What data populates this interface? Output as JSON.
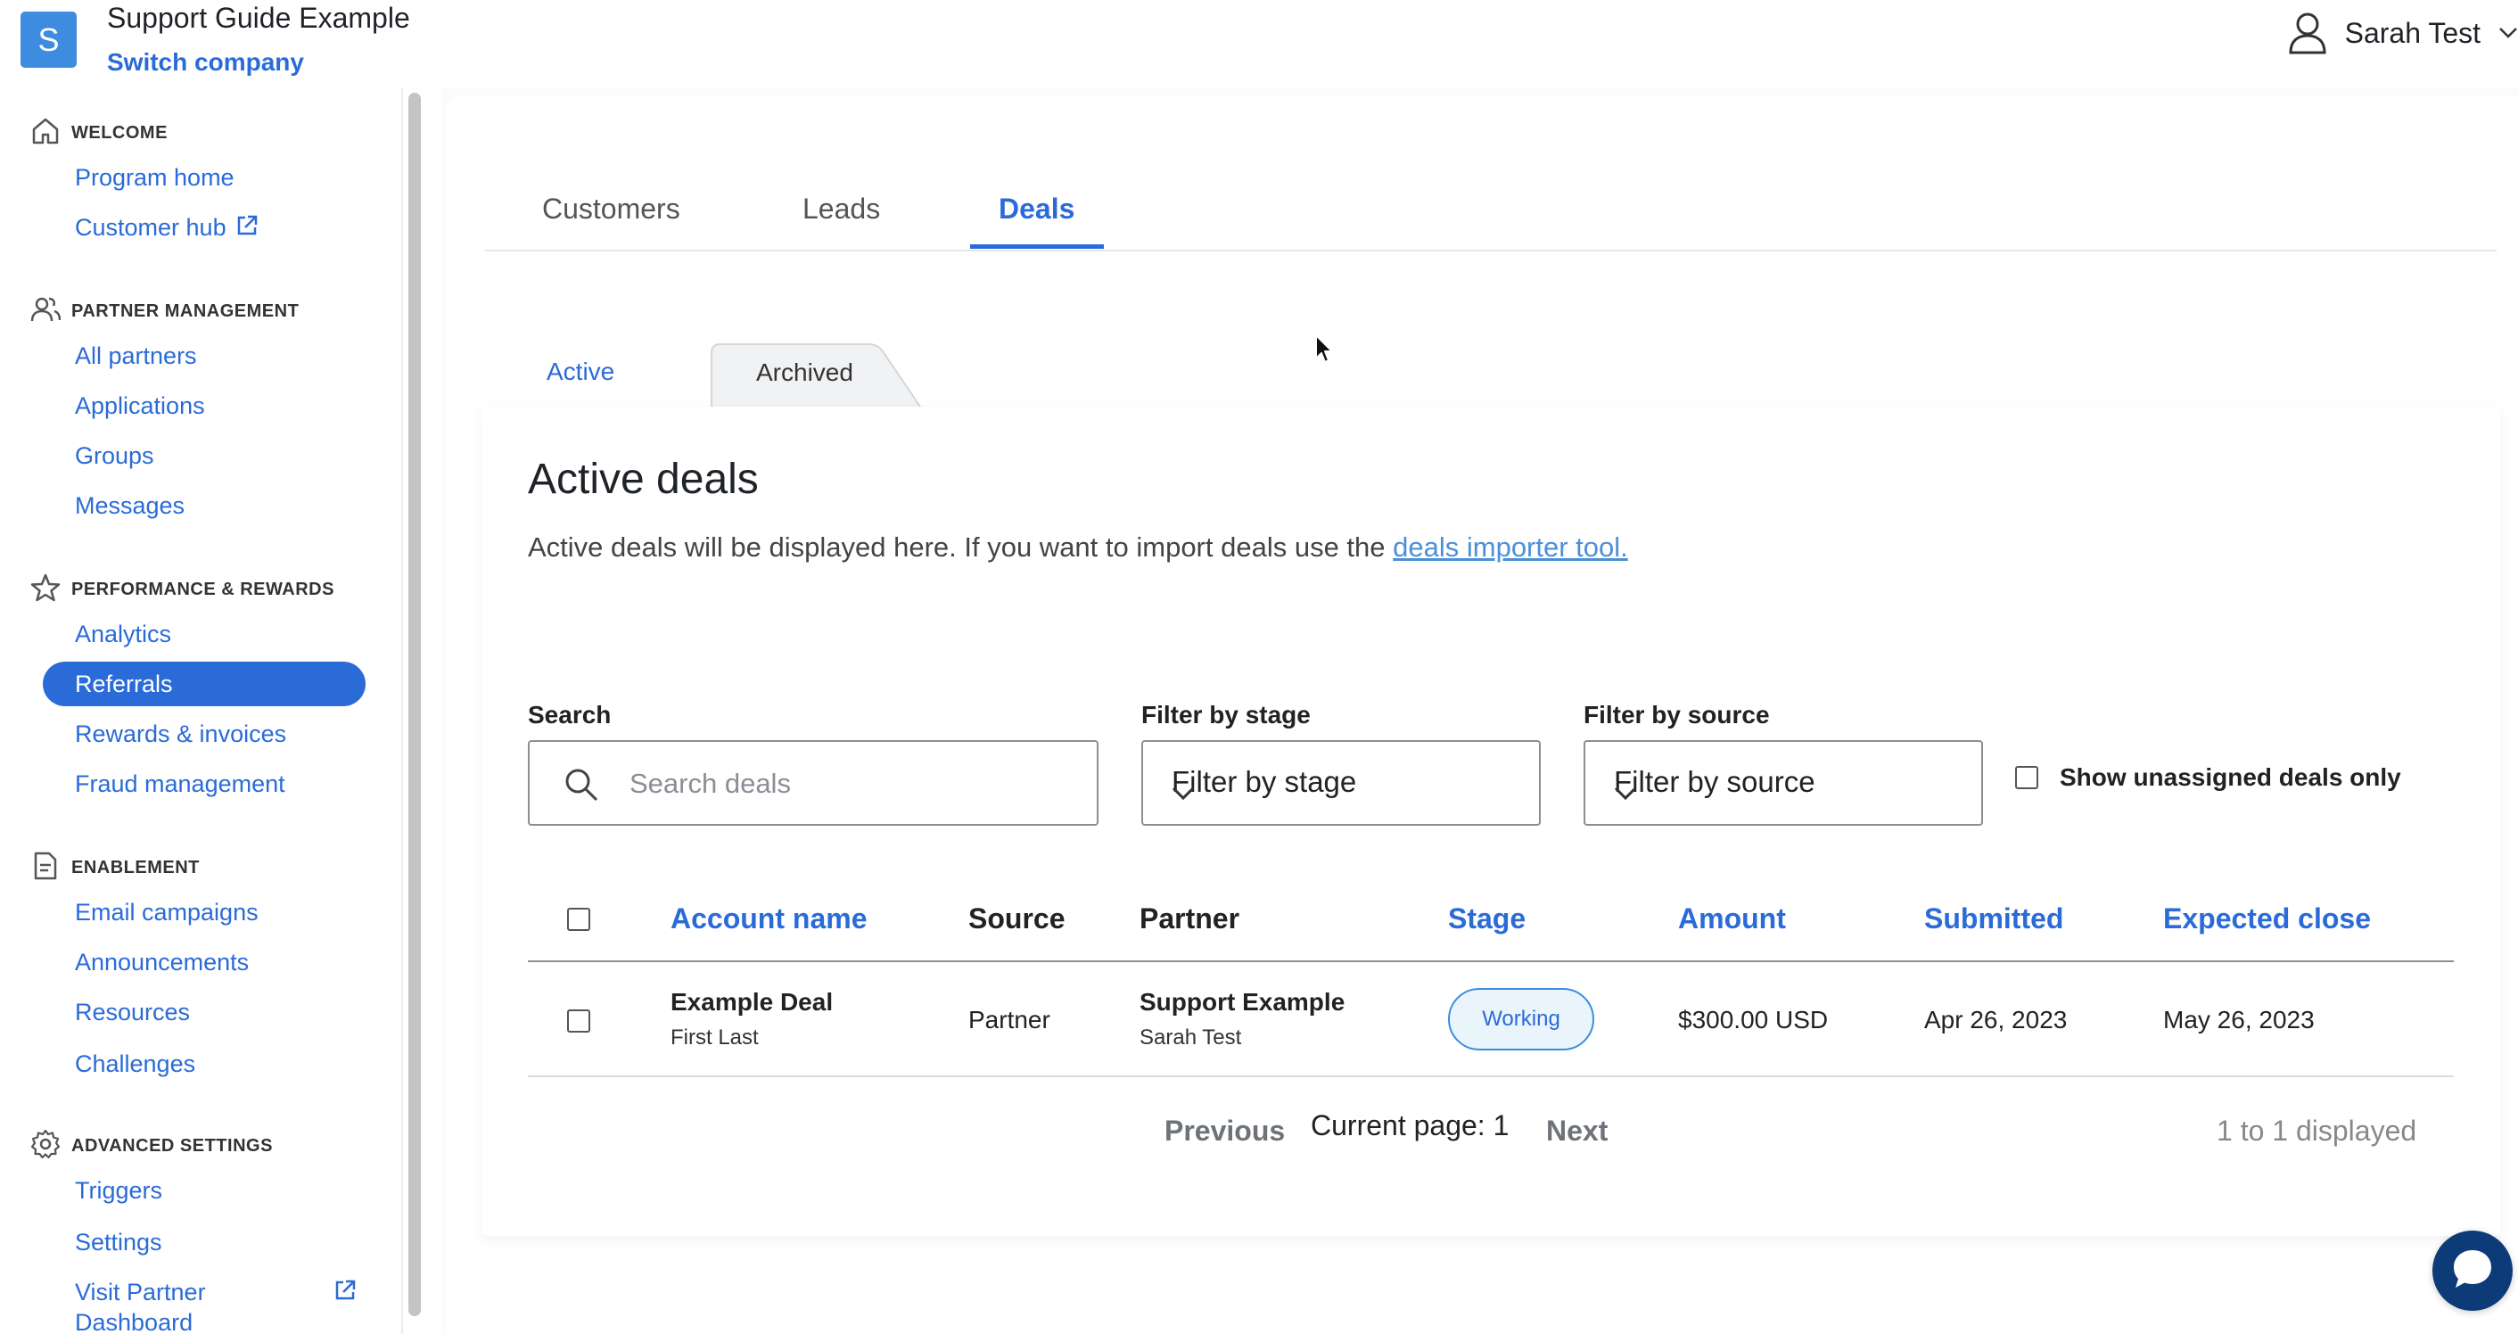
{
  "topbar": {
    "logo_letter": "S",
    "company_name": "Support Guide Example",
    "switch_company": "Switch company",
    "user_name": "Sarah Test"
  },
  "sidebar": {
    "sections": [
      {
        "label": "WELCOME",
        "icon": "home-icon",
        "items": [
          "Program home",
          "Customer hub"
        ]
      },
      {
        "label": "PARTNER MANAGEMENT",
        "icon": "users-icon",
        "items": [
          "All partners",
          "Applications",
          "Groups",
          "Messages"
        ]
      },
      {
        "label": "PERFORMANCE & REWARDS",
        "icon": "star-icon",
        "items": [
          "Analytics",
          "Referrals",
          "Rewards & invoices",
          "Fraud management"
        ]
      },
      {
        "label": "ENABLEMENT",
        "icon": "document-icon",
        "items": [
          "Email campaigns",
          "Announcements",
          "Resources",
          "Challenges"
        ]
      },
      {
        "label": "ADVANCED SETTINGS",
        "icon": "gear-icon",
        "items": [
          "Triggers",
          "Settings",
          "Visit Partner",
          "Dashboard"
        ]
      }
    ],
    "active_item": "Referrals"
  },
  "tabs": [
    "Customers",
    "Leads",
    "Deals"
  ],
  "active_tab": "Deals",
  "subtabs": {
    "active": "Active",
    "archived": "Archived"
  },
  "page": {
    "title": "Active deals",
    "description": "Active deals will be displayed here. If you want to import deals use the ",
    "link": "deals importer tool."
  },
  "filters": {
    "search_label": "Search",
    "search_placeholder": "Search deals",
    "stage_label": "Filter by stage",
    "stage_value": "Filter by stage",
    "source_label": "Filter by source",
    "source_value": "Filter by source",
    "unassigned_label": "Show unassigned deals only"
  },
  "table": {
    "columns": [
      "Account name",
      "Source",
      "Partner",
      "Stage",
      "Amount",
      "Submitted",
      "Expected close"
    ],
    "rows": [
      {
        "account_name": "Example Deal",
        "account_sub": "First Last",
        "source": "Partner",
        "partner": "Support Example",
        "partner_sub": "Sarah Test",
        "stage": "Working",
        "amount": "$300.00 USD",
        "submitted": "Apr 26, 2023",
        "expected_close": "May 26, 2023"
      }
    ]
  },
  "pagination": {
    "previous": "Previous",
    "current": "Current page: 1",
    "next": "Next",
    "count": "1 to 1 displayed"
  },
  "colors": {
    "accent": "#2a6bd8",
    "logo": "#3d8ce0",
    "chat": "#0d3b78"
  }
}
